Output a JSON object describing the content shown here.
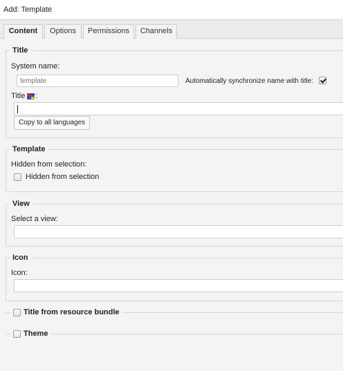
{
  "window": {
    "title": "Add: Template"
  },
  "tabs": [
    {
      "label": "Content",
      "active": true
    },
    {
      "label": "Options",
      "active": false
    },
    {
      "label": "Permissions",
      "active": false
    },
    {
      "label": "Channels",
      "active": false
    }
  ],
  "title_section": {
    "legend": "Title",
    "system_name_label": "System name:",
    "system_name_placeholder": "template",
    "sync_label": "Automatically synchronize name with title:",
    "sync_checked": true,
    "title_label": "Title",
    "title_suffix": ":",
    "title_icon": "flag-icon",
    "title_value": "",
    "copy_button": "Copy to all languages"
  },
  "template_section": {
    "legend": "Template",
    "hidden_label": "Hidden from selection:",
    "hidden_checkbox_label": "Hidden from selection",
    "hidden_checked": false
  },
  "view_section": {
    "legend": "View",
    "select_label": "Select a view:",
    "select_value": ""
  },
  "icon_section": {
    "legend": "Icon",
    "icon_label": "Icon:",
    "icon_value": ""
  },
  "bundle_section": {
    "legend": "Title from resource bundle",
    "checked": false
  },
  "theme_section": {
    "legend": "Theme",
    "checked": false
  },
  "colors": {
    "background": "#f4f4f4",
    "border": "#d6d6d6",
    "tabbar": "#ececec"
  }
}
